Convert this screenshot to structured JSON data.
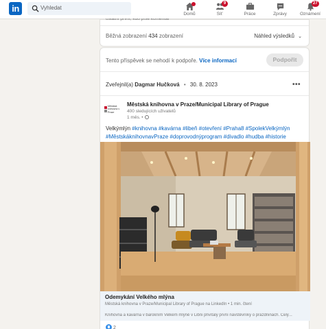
{
  "nav": {
    "logo": "in",
    "search_placeholder": "Vyhledat",
    "items": [
      {
        "label": "Domů",
        "icon": "home-icon",
        "badge": ""
      },
      {
        "label": "Síť",
        "icon": "network-icon",
        "badge": "9"
      },
      {
        "label": "Práce",
        "icon": "briefcase-icon",
        "badge": ""
      },
      {
        "label": "Zprávy",
        "icon": "messaging-icon",
        "badge": ""
      },
      {
        "label": "Oznámení",
        "icon": "bell-icon",
        "badge": "27"
      }
    ],
    "accent": "#0a66c2",
    "badge_color": "#cb112d"
  },
  "analytics": {
    "cut_text": "ostatní první, kdo píše komentář",
    "impressions_label": "Běžná zobrazení",
    "impressions_value": "434",
    "impressions_unit": "zobrazení",
    "sort_label": "Náhled výsledků"
  },
  "promotion": {
    "text": "Tento příspěvek se nehodí k podpoře.",
    "link": "Více informací",
    "button": "Podpořit"
  },
  "post": {
    "published_label": "Zveřejnil(a)",
    "published_by": "Dagmar Hučková",
    "date": "30. 8. 2023",
    "author": {
      "name": "Městská knihovna v Praze/Municipal Library of Prague",
      "followers": "400 sledujících uživatelů",
      "time": "1 měs. •",
      "logo_text": "Městská knihovna v Praze"
    },
    "text_plain": "Velkýmlýn",
    "hashtags_line1": "#knihovna #kavárna #libeň #otevření #Praha8 #SpolekVelkýmlýn",
    "hashtags_line2": "#MěstskáknihovnavPraze #doprovodnýprogram #divadlo #hudba #historie",
    "link": {
      "title": "Odemykání Velkého mlýna",
      "source": "Městská knihovna v Praze/Municipal Library of Prague na LinkedIn • 1 min. čtení",
      "description": "Knihovna a kavárna v barokním Velkém mlýně v Libni přivítaly první návštěvníky o prázdninách. Celý..."
    },
    "reactions": "2"
  }
}
